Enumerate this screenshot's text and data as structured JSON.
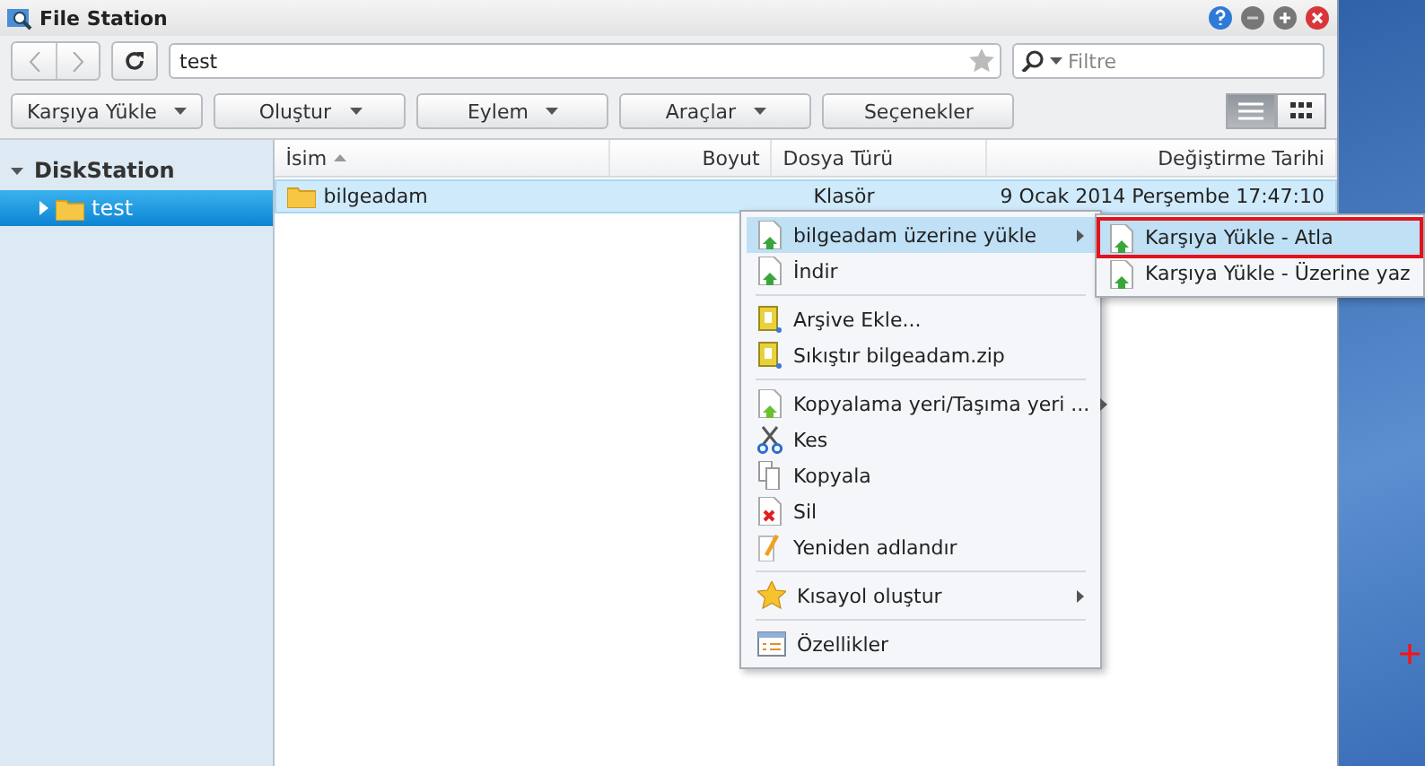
{
  "window": {
    "title": "File Station"
  },
  "path": {
    "value": "test"
  },
  "filter": {
    "placeholder": "Filtre"
  },
  "toolbar": [
    {
      "label": "Karşıya Yükle",
      "dropdown": true
    },
    {
      "label": "Oluştur",
      "dropdown": true
    },
    {
      "label": "Eylem",
      "dropdown": true
    },
    {
      "label": "Araçlar",
      "dropdown": true
    },
    {
      "label": "Seçenekler",
      "dropdown": false
    }
  ],
  "views": [
    {
      "kind": "list",
      "selected": true
    },
    {
      "kind": "grid",
      "selected": false
    }
  ],
  "sidebar": {
    "root": {
      "label": "DiskStation",
      "expanded": true,
      "children": [
        {
          "label": "test",
          "selected": true,
          "expanded": false
        }
      ]
    }
  },
  "table": {
    "columns": [
      {
        "label": "İsim",
        "sorted": true
      },
      {
        "label": "Boyut",
        "sorted": false
      },
      {
        "label": "Dosya Türü",
        "sorted": false
      },
      {
        "label": "Değiştirme Tarihi",
        "sorted": false
      }
    ],
    "rows": [
      {
        "name": "bilgeadam",
        "type": "Klasör",
        "date": "9 Ocak 2014 Perşembe 17:47:10",
        "selected": true
      }
    ]
  },
  "context_menu": {
    "items": [
      {
        "kind": "item",
        "label": "bilgeadam üzerine yükle",
        "submenu": true,
        "selected": true
      },
      {
        "kind": "item",
        "label": "İndir",
        "submenu": false,
        "selected": false
      },
      {
        "kind": "separator"
      },
      {
        "kind": "item",
        "label": "Arşive Ekle...",
        "submenu": false,
        "selected": false
      },
      {
        "kind": "item",
        "label": "Sıkıştır bilgeadam.zip",
        "submenu": false,
        "selected": false
      },
      {
        "kind": "separator"
      },
      {
        "kind": "item",
        "label": "Kopyalama yeri/Taşıma yeri ...",
        "submenu": true,
        "selected": false
      },
      {
        "kind": "item",
        "label": "Kes",
        "submenu": false,
        "selected": false
      },
      {
        "kind": "item",
        "label": "Kopyala",
        "submenu": false,
        "selected": false
      },
      {
        "kind": "item",
        "label": "Sil",
        "submenu": false,
        "selected": false
      },
      {
        "kind": "item",
        "label": "Yeniden adlandır",
        "submenu": false,
        "selected": false
      },
      {
        "kind": "separator"
      },
      {
        "kind": "item",
        "label": "Kısayol oluştur",
        "submenu": true,
        "selected": false
      },
      {
        "kind": "separator"
      },
      {
        "kind": "item",
        "label": "Özellikler",
        "submenu": false,
        "selected": false
      }
    ]
  },
  "submenu": {
    "items": [
      {
        "label": "Karşıya Yükle - Atla",
        "selected": true
      },
      {
        "label": "Karşıya Yükle - Üzerine yaz",
        "selected": false
      }
    ]
  }
}
